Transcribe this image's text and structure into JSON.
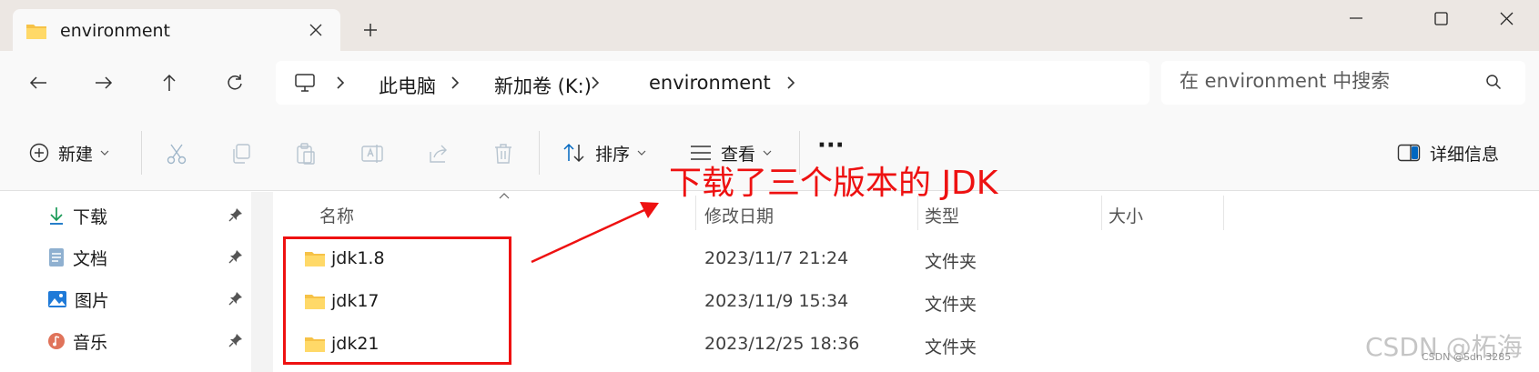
{
  "window": {
    "tab_title": "environment",
    "new_tab_symbol": "+",
    "controls": [
      "minimize-icon",
      "maximize-icon",
      "close-icon"
    ]
  },
  "address_bar": {
    "nav_icons": [
      "back-arrow-icon",
      "forward-arrow-icon",
      "up-arrow-icon",
      "refresh-icon"
    ],
    "root_icon": "this-pc-icon",
    "breadcrumbs": [
      "此电脑",
      "新加卷 (K:)",
      "environment"
    ]
  },
  "search": {
    "placeholder": "在 environment 中搜索"
  },
  "command_bar": {
    "new_label": "新建",
    "sort_label": "排序",
    "view_label": "查看",
    "more_label": "···",
    "details_label": "详细信息",
    "tool_icons": [
      "cut-icon",
      "copy-icon",
      "paste-icon",
      "rename-icon",
      "share-icon",
      "delete-icon"
    ]
  },
  "nav_pane": {
    "items": [
      {
        "label": "下载",
        "icon": "download-icon"
      },
      {
        "label": "文档",
        "icon": "documents-icon"
      },
      {
        "label": "图片",
        "icon": "pictures-icon"
      },
      {
        "label": "音乐",
        "icon": "music-icon"
      }
    ]
  },
  "file_list": {
    "columns": {
      "name": "名称",
      "date": "修改日期",
      "type": "类型",
      "size": "大小"
    },
    "rows": [
      {
        "name": "jdk1.8",
        "date": "2023/11/7 21:24",
        "type": "文件夹"
      },
      {
        "name": "jdk17",
        "date": "2023/11/9 15:34",
        "type": "文件夹"
      },
      {
        "name": "jdk21",
        "date": "2023/12/25 18:36",
        "type": "文件夹"
      }
    ]
  },
  "annotation": {
    "text": "下载了三个版本的 JDK",
    "color": "#ee1111"
  },
  "watermark": {
    "main": "CSDN @柘海",
    "sub": "CSDN @Sdn 3285"
  },
  "colors": {
    "titlebar_bg": "#ece7e3",
    "toolbar_bg": "#f9f9f9",
    "folder_yellow": "#f8c74a",
    "accent_blue": "#0067c0"
  }
}
